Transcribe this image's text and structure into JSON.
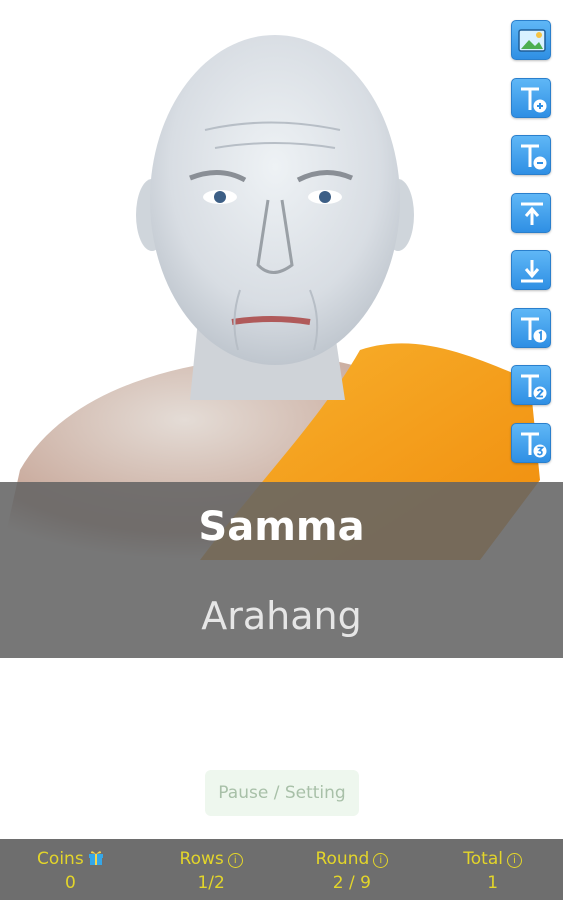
{
  "portrait": {
    "subject": "monk portrait photo"
  },
  "toolbar": {
    "icons": [
      "image-icon",
      "text-increase-icon",
      "text-decrease-icon",
      "move-up-icon",
      "move-down-icon",
      "text-style-1-icon",
      "text-style-2-icon",
      "text-style-3-icon"
    ]
  },
  "overlay": {
    "line1": "Samma",
    "line2": "Arahang"
  },
  "pause_button": {
    "label": "Pause / Setting"
  },
  "stats": [
    {
      "label": "Coins",
      "value": "0"
    },
    {
      "label": "Rows",
      "value": "1/2"
    },
    {
      "label": "Round",
      "value": "2 / 9"
    },
    {
      "label": "Total",
      "value": "1"
    }
  ],
  "colors": {
    "accent": "#2f8fe4",
    "stat_text": "#e3d52a",
    "robe": "#f5a31a"
  }
}
